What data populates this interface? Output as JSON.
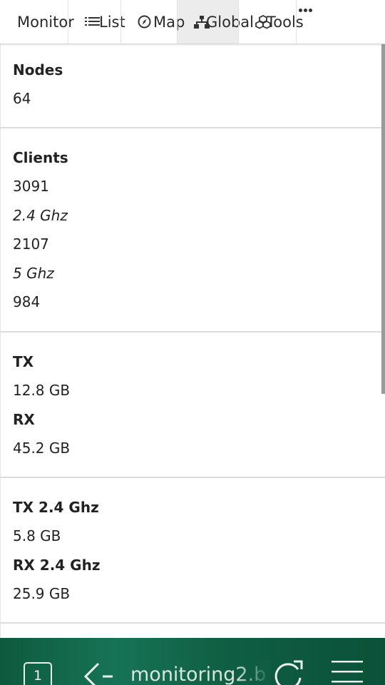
{
  "nav": {
    "items": [
      {
        "label": "Monitor",
        "icon": null
      },
      {
        "label": "List",
        "icon": "list-icon"
      },
      {
        "label": "Map",
        "icon": "compass-icon"
      },
      {
        "label": "Global",
        "icon": "sitemap-icon"
      },
      {
        "label": "Tools",
        "icon": "cubes-icon"
      }
    ],
    "more_icon": "more-dots-icon"
  },
  "cards": [
    {
      "rows": [
        {
          "text": "Nodes",
          "style": "bold"
        },
        {
          "text": "64",
          "style": "normal"
        }
      ]
    },
    {
      "rows": [
        {
          "text": "Clients",
          "style": "bold"
        },
        {
          "text": "3091",
          "style": "normal"
        },
        {
          "text": "2.4 Ghz",
          "style": "italic"
        },
        {
          "text": "2107",
          "style": "normal"
        },
        {
          "text": "5 Ghz",
          "style": "italic"
        },
        {
          "text": "984",
          "style": "normal"
        }
      ]
    },
    {
      "rows": [
        {
          "text": "TX",
          "style": "bold"
        },
        {
          "text": "12.8 GB",
          "style": "normal"
        },
        {
          "text": "RX",
          "style": "bold"
        },
        {
          "text": "45.2 GB",
          "style": "normal"
        }
      ]
    },
    {
      "rows": [
        {
          "text": "TX 2.4 Ghz",
          "style": "bold"
        },
        {
          "text": "5.8 GB",
          "style": "normal"
        },
        {
          "text": "RX 2.4 Ghz",
          "style": "bold"
        },
        {
          "text": "25.9 GB",
          "style": "normal"
        }
      ]
    }
  ],
  "browser_bar": {
    "tab_count": "1",
    "url": "monitoring2.b",
    "icons": [
      "tabs-icon",
      "back-icon",
      "reload-icon",
      "menu-icon"
    ]
  },
  "colors": {
    "bottom_bar": "#0f5e43",
    "nav_active": "#ececec",
    "text": "#222222"
  }
}
